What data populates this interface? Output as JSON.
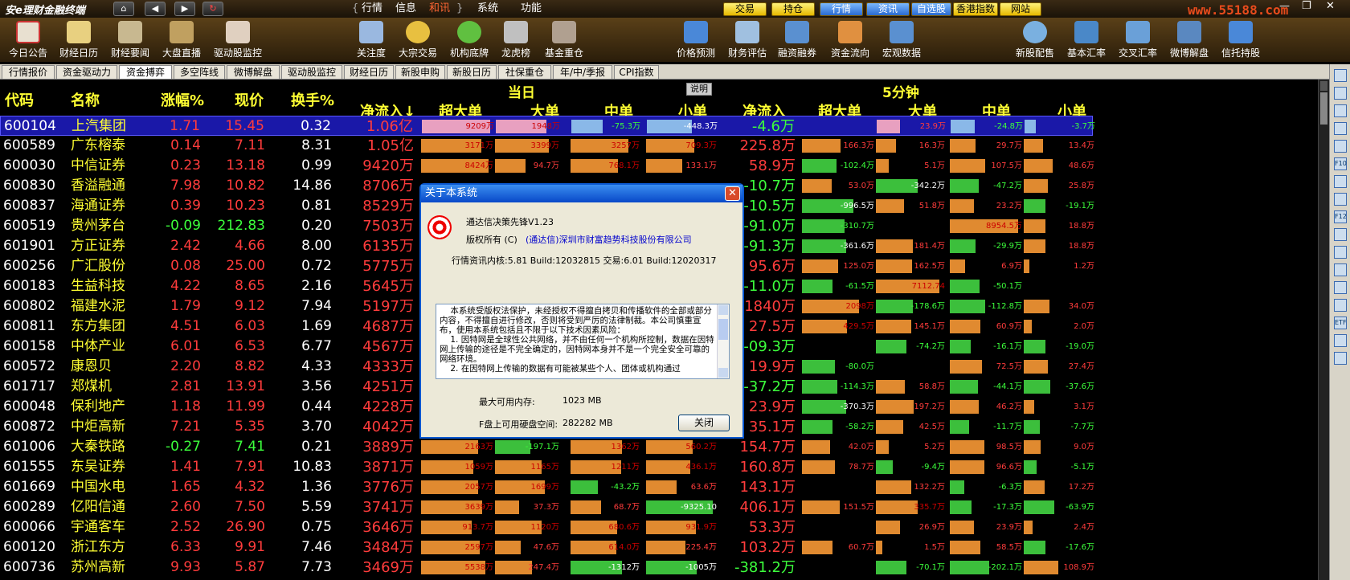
{
  "titlebar": {
    "app_title": "安e理财金融终端",
    "menus": [
      "行情",
      "信息",
      "和讯",
      "系统",
      "功能"
    ],
    "active_menu": "和讯",
    "quick_buttons": [
      "交易",
      "持仓",
      "行情",
      "资讯",
      "自选股",
      "香港指数",
      "网站"
    ],
    "watermark": "www.55188.com"
  },
  "toolbar": {
    "tools": [
      "今日公告",
      "财经日历",
      "财经要闻",
      "大盘直播",
      "驱动股监控",
      "关注度",
      "大宗交易",
      "机构底牌",
      "龙虎榜",
      "基金重仓",
      "价格预测",
      "财务评估",
      "融资融券",
      "资金流向",
      "宏观数据",
      "新股配售",
      "基本汇率",
      "交叉汇率",
      "微博解盘",
      "信托持股"
    ]
  },
  "tabs": [
    "行情报价",
    "资金驱动力",
    "资金搏弈",
    "多空阵线",
    "微博解盘",
    "驱动股监控",
    "财经日历",
    "新股申购",
    "新股日历",
    "社保重仓",
    "年/中/季报",
    "CPI指数"
  ],
  "active_tab": "资金搏弈",
  "grid": {
    "section_today": "当日",
    "section_5min": "5分钟",
    "explain_button": "说明",
    "headers": {
      "code": "代码",
      "name": "名称",
      "change": "涨幅%",
      "price": "现价",
      "turnover": "换手%",
      "net_inflow": "净流入↓",
      "super_large": "超大单",
      "large": "大单",
      "medium": "中单",
      "small": "小单",
      "net_inflow_5m": "净流入",
      "super_large_5m": "超大单",
      "large_5m": "大单",
      "medium_5m": "中单",
      "small_5m": "小单"
    },
    "rows": [
      {
        "code": "600104",
        "name": "上汽集团",
        "chg": "1.71",
        "price": "15.45",
        "turn": "0.32",
        "net": "1.06亿",
        "sl": "9209万",
        "lg": "1948万",
        "md": "-75.3万",
        "sm": "-448.3万",
        "net5": "-4.6万",
        "sl5": "",
        "lg5": "23.9万",
        "md5": "-24.8万",
        "sm5": "-3.7万"
      },
      {
        "code": "600589",
        "name": "广东榕泰",
        "chg": "0.14",
        "price": "7.11",
        "turn": "8.31",
        "net": "1.05亿",
        "sl": "3171万",
        "lg": "3399万",
        "md": "3257万",
        "sm": "709.3万",
        "net5": "225.8万",
        "sl5": "166.3万",
        "lg5": "16.3万",
        "md5": "29.7万",
        "sm5": "13.4万"
      },
      {
        "code": "600030",
        "name": "中信证券",
        "chg": "0.23",
        "price": "13.18",
        "turn": "0.99",
        "net": "9420万",
        "sl": "8424万",
        "lg": "94.7万",
        "md": "768.1万",
        "sm": "133.1万",
        "net5": "58.9万",
        "sl5": "-102.4万",
        "lg5": "5.1万",
        "md5": "107.5万",
        "sm5": "48.6万"
      },
      {
        "code": "600830",
        "name": "香溢融通",
        "chg": "7.98",
        "price": "10.82",
        "turn": "14.86",
        "net": "8706万",
        "sl": "",
        "lg": "",
        "md": "",
        "sm": "",
        "net5": "-10.7万",
        "sl5": "53.0万",
        "lg5": "-342.2万",
        "md5": "-47.2万",
        "sm5": "25.8万"
      },
      {
        "code": "600837",
        "name": "海通证券",
        "chg": "0.39",
        "price": "10.23",
        "turn": "0.81",
        "net": "8529万",
        "sl": "",
        "lg": "",
        "md": "",
        "sm": "",
        "net5": "-10.5万",
        "sl5": "-996.5万",
        "lg5": "51.8万",
        "md5": "23.2万",
        "sm5": "-19.1万"
      },
      {
        "code": "600519",
        "name": "贵州茅台",
        "chg": "-0.09",
        "price": "212.83",
        "turn": "0.20",
        "net": "7503万",
        "sl": "",
        "lg": "",
        "md": "",
        "sm": "",
        "net5": "-91.0万",
        "sl5": "-310.7万",
        "lg5": "",
        "md5": "8954.5万",
        "sm5": "18.8万"
      },
      {
        "code": "601901",
        "name": "方正证券",
        "chg": "2.42",
        "price": "4.66",
        "turn": "8.00",
        "net": "6135万",
        "sl": "",
        "lg": "",
        "md": "",
        "sm": "",
        "net5": "-91.3万",
        "sl5": "-361.6万",
        "lg5": "181.4万",
        "md5": "-29.9万",
        "sm5": "18.8万"
      },
      {
        "code": "600256",
        "name": "广汇股份",
        "chg": "0.08",
        "price": "25.00",
        "turn": "0.72",
        "net": "5775万",
        "sl": "",
        "lg": "",
        "md": "",
        "sm": "",
        "net5": "95.6万",
        "sl5": "125.0万",
        "lg5": "162.5万",
        "md5": "6.9万",
        "sm5": "1.2万"
      },
      {
        "code": "600183",
        "name": "生益科技",
        "chg": "4.22",
        "price": "8.65",
        "turn": "2.16",
        "net": "5645万",
        "sl": "",
        "lg": "",
        "md": "",
        "sm": "",
        "net5": "-11.0万",
        "sl5": "-61.5万",
        "lg5": "7112.74",
        "md5": "-50.1万",
        "sm5": ""
      },
      {
        "code": "600802",
        "name": "福建水泥",
        "chg": "1.79",
        "price": "9.12",
        "turn": "7.94",
        "net": "5197万",
        "sl": "",
        "lg": "",
        "md": "",
        "sm": "",
        "net5": "1840万",
        "sl5": "2098万",
        "lg5": "-178.6万",
        "md5": "-112.8万",
        "sm5": "34.0万"
      },
      {
        "code": "600811",
        "name": "东方集团",
        "chg": "4.51",
        "price": "6.03",
        "turn": "1.69",
        "net": "4687万",
        "sl": "",
        "lg": "",
        "md": "",
        "sm": "",
        "net5": "27.5万",
        "sl5": "429.5万",
        "lg5": "145.1万",
        "md5": "60.9万",
        "sm5": "2.0万"
      },
      {
        "code": "600158",
        "name": "中体产业",
        "chg": "6.01",
        "price": "6.53",
        "turn": "6.77",
        "net": "4567万",
        "sl": "",
        "lg": "",
        "md": "",
        "sm": "",
        "net5": "-09.3万",
        "sl5": "",
        "lg5": "-74.2万",
        "md5": "-16.1万",
        "sm5": "-19.0万"
      },
      {
        "code": "600572",
        "name": "康恩贝",
        "chg": "2.20",
        "price": "8.82",
        "turn": "4.33",
        "net": "4333万",
        "sl": "",
        "lg": "",
        "md": "",
        "sm": "",
        "net5": "19.9万",
        "sl5": "-80.0万",
        "lg5": "",
        "md5": "72.5万",
        "sm5": "27.4万"
      },
      {
        "code": "601717",
        "name": "郑煤机",
        "chg": "2.81",
        "price": "13.91",
        "turn": "3.56",
        "net": "4251万",
        "sl": "",
        "lg": "",
        "md": "",
        "sm": "",
        "net5": "-37.2万",
        "sl5": "-114.3万",
        "lg5": "58.8万",
        "md5": "-44.1万",
        "sm5": "-37.6万"
      },
      {
        "code": "600048",
        "name": "保利地产",
        "chg": "1.18",
        "price": "11.99",
        "turn": "0.44",
        "net": "4228万",
        "sl": "",
        "lg": "",
        "md": "",
        "sm": "",
        "net5": "23.9万",
        "sl5": "-370.3万",
        "lg5": "197.2万",
        "md5": "46.2万",
        "sm5": "3.1万"
      },
      {
        "code": "600872",
        "name": "中炬高新",
        "chg": "7.21",
        "price": "5.35",
        "turn": "3.70",
        "net": "4042万",
        "sl": "",
        "lg": "",
        "md": "",
        "sm": "",
        "net5": "35.1万",
        "sl5": "-58.2万",
        "lg5": "42.5万",
        "md5": "-11.7万",
        "sm5": "-7.7万"
      },
      {
        "code": "601006",
        "name": "大秦铁路",
        "chg": "-0.27",
        "price": "7.41",
        "turn": "0.21",
        "net": "3889万",
        "sl": "2163万",
        "lg": "-197.1万",
        "md": "1362万",
        "sm": "560.2万",
        "net5": "154.7万",
        "sl5": "42.0万",
        "lg5": "5.2万",
        "md5": "98.5万",
        "sm5": "9.0万"
      },
      {
        "code": "601555",
        "name": "东吴证券",
        "chg": "1.41",
        "price": "7.91",
        "turn": "10.83",
        "net": "3871万",
        "sl": "1059万",
        "lg": "1165万",
        "md": "1211万",
        "sm": "436.1万",
        "net5": "160.8万",
        "sl5": "78.7万",
        "lg5": "-9.4万",
        "md5": "96.6万",
        "sm5": "-5.1万"
      },
      {
        "code": "601669",
        "name": "中国水电",
        "chg": "1.65",
        "price": "4.32",
        "turn": "1.36",
        "net": "3776万",
        "sl": "2057万",
        "lg": "1699万",
        "md": "-43.2万",
        "sm": "63.6万",
        "net5": "143.1万",
        "sl5": "",
        "lg5": "132.2万",
        "md5": "-6.3万",
        "sm5": "17.2万"
      },
      {
        "code": "600289",
        "name": "亿阳信通",
        "chg": "2.60",
        "price": "7.50",
        "turn": "5.59",
        "net": "3741万",
        "sl": "3639万",
        "lg": "37.3万",
        "md": "68.7万",
        "sm": "-9325.10",
        "net5": "406.1万",
        "sl5": "151.5万",
        "lg5": "335.7万",
        "md5": "-17.3万",
        "sm5": "-63.9万"
      },
      {
        "code": "600066",
        "name": "宇通客车",
        "chg": "2.52",
        "price": "26.90",
        "turn": "0.75",
        "net": "3646万",
        "sl": "913.7万",
        "lg": "1120万",
        "md": "680.6万",
        "sm": "931.9万",
        "net5": "53.3万",
        "sl5": "",
        "lg5": "26.9万",
        "md5": "23.9万",
        "sm5": "2.4万"
      },
      {
        "code": "600120",
        "name": "浙江东方",
        "chg": "6.33",
        "price": "9.91",
        "turn": "7.46",
        "net": "3484万",
        "sl": "2597万",
        "lg": "47.6万",
        "md": "614.0万",
        "sm": "225.4万",
        "net5": "103.2万",
        "sl5": "60.7万",
        "lg5": "1.5万",
        "md5": "58.5万",
        "sm5": "-17.6万"
      },
      {
        "code": "600736",
        "name": "苏州高新",
        "chg": "9.93",
        "price": "5.87",
        "turn": "7.73",
        "net": "3469万",
        "sl": "5538万",
        "lg": "247.4万",
        "md": "-1312万",
        "sm": "-1005万",
        "net5": "-381.2万",
        "sl5": "",
        "lg5": "-70.1万",
        "md5": "-202.1万",
        "sm5": "108.9万"
      }
    ]
  },
  "dialog": {
    "title": "关于本系统",
    "close_x": "✕",
    "product": "通达信决策先锋V1.23",
    "copyright_label": "版权所有 (C)",
    "copyright_holder": "(通达信)深圳市财富趋势科技股份有限公司",
    "version_line": "行情资讯内核:5.81 Build:12032815  交易:6.01 Build:12020317",
    "license_text": "    本系统受版权法保护，未经授权不得擅自拷贝和传播软件的全部或部分内容，不得擅自进行修改，否则将受到严厉的法律制裁。本公司慎重宣布，使用本系统包括且不限于以下技术因素风险：\n    1. 因特网是全球性公共网络，并不由任何一个机构所控制，数据在因特网上传输的途径是不完全确定的，因特网本身并不是一个完全安全可靠的网络环境。\n    2. 在因特网上传输的数据有可能被某些个人、团体或机构通过",
    "mem_label": "最大可用内存:",
    "mem_value": "1023 MB",
    "disk_label": "F盘上可用硬盘空间:",
    "disk_value": "282282 MB",
    "close_button": "关闭"
  }
}
